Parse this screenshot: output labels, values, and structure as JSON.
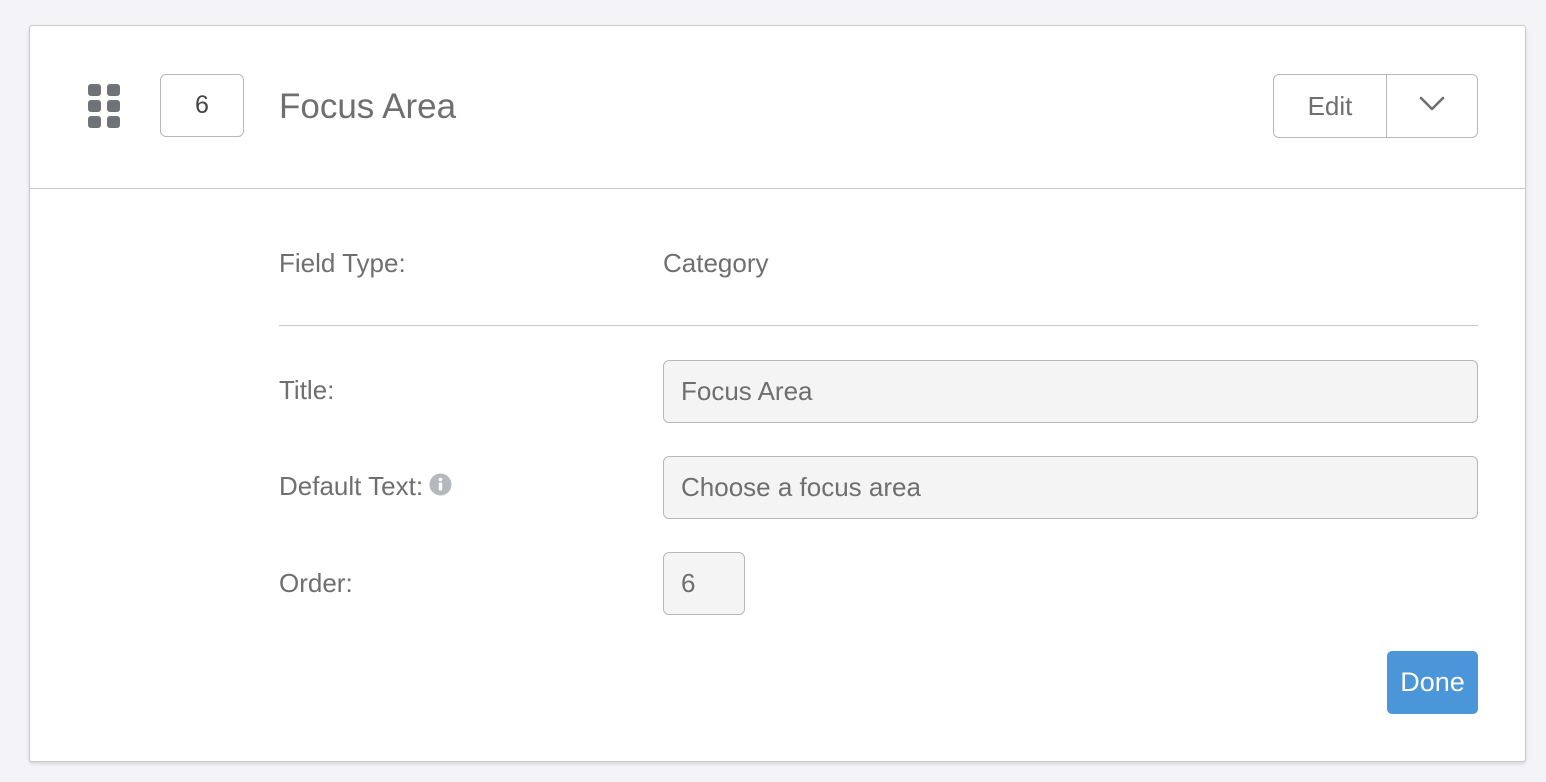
{
  "header": {
    "order_badge": "6",
    "title": "Focus Area",
    "edit_label": "Edit",
    "toggle_icon": "chevron-down-icon",
    "drag_icon": "drag-handle-icon"
  },
  "details": {
    "field_type_label": "Field Type:",
    "field_type_value": "Category",
    "title_label": "Title:",
    "title_value": "Focus Area",
    "default_text_label": "Default Text:",
    "default_text_value": "Choose a focus area",
    "info_icon": "info-icon",
    "order_label": "Order:",
    "order_value": "6"
  },
  "footer": {
    "done_label": "Done"
  },
  "colors": {
    "accent": "#4b95d9",
    "text": "#6f6f6f",
    "border": "#b8b8b8",
    "input_bg": "#f4f4f4",
    "page_bg": "#f4f4f8"
  }
}
